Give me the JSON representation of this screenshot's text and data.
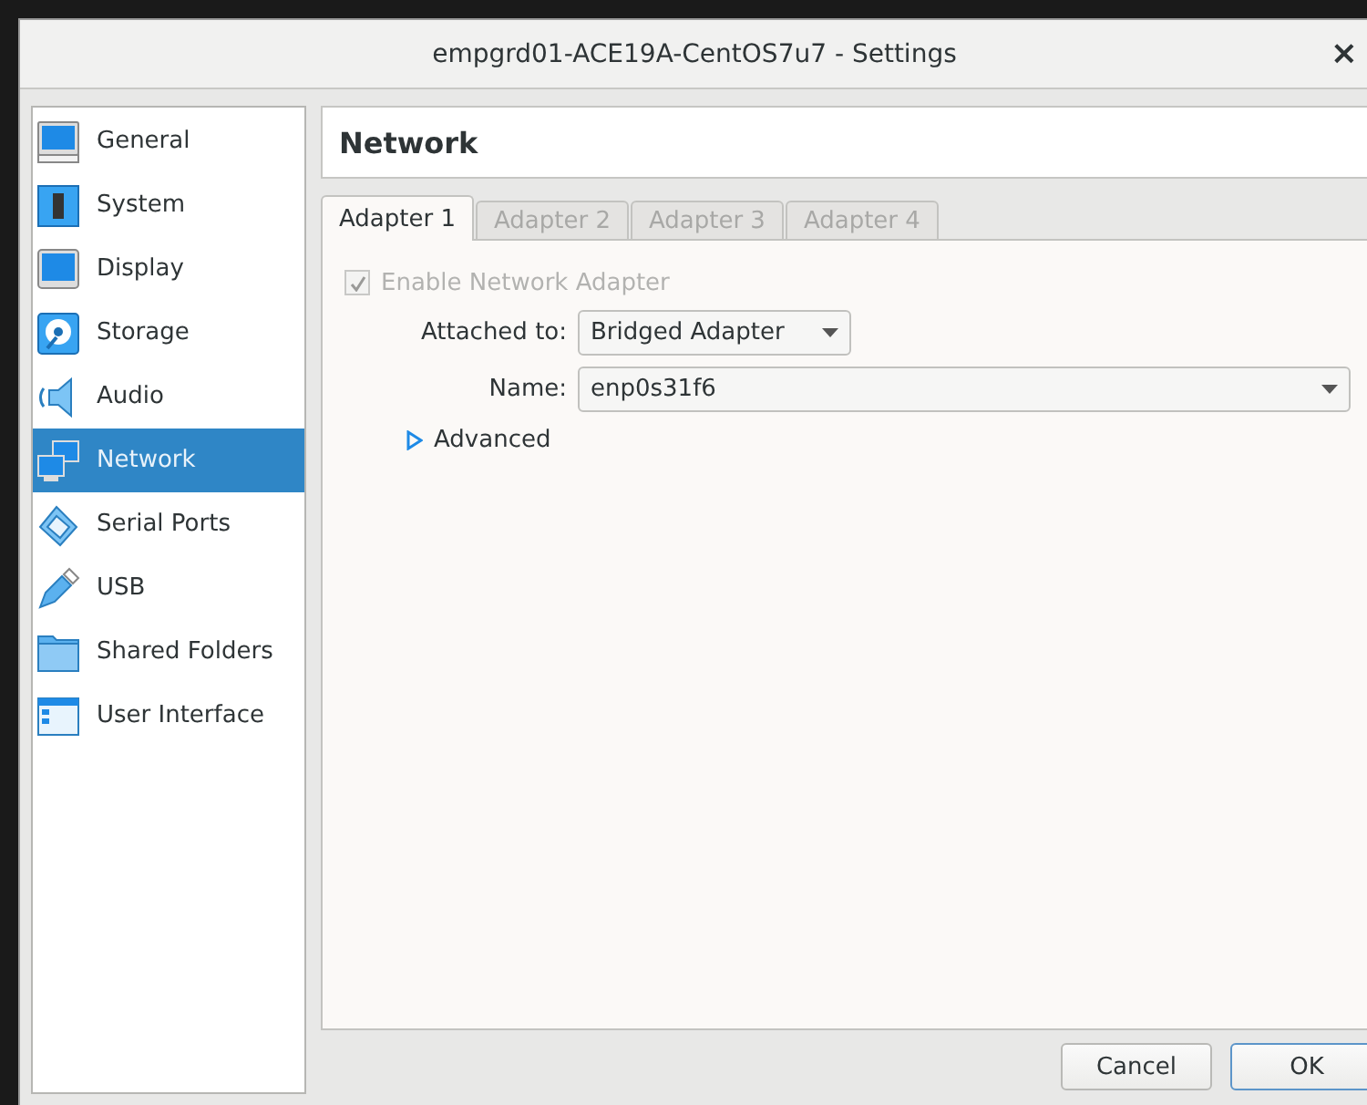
{
  "window": {
    "title": "empgrd01-ACE19A-CentOS7u7 - Settings",
    "close": "×"
  },
  "sidebar": {
    "items": [
      {
        "label": "General",
        "selected": false
      },
      {
        "label": "System",
        "selected": false
      },
      {
        "label": "Display",
        "selected": false
      },
      {
        "label": "Storage",
        "selected": false
      },
      {
        "label": "Audio",
        "selected": false
      },
      {
        "label": "Network",
        "selected": true
      },
      {
        "label": "Serial Ports",
        "selected": false
      },
      {
        "label": "USB",
        "selected": false
      },
      {
        "label": "Shared Folders",
        "selected": false
      },
      {
        "label": "User Interface",
        "selected": false
      }
    ]
  },
  "page": {
    "title": "Network"
  },
  "tabs": [
    {
      "label": "Adapter 1",
      "selected": true
    },
    {
      "label": "Adapter 2",
      "selected": false
    },
    {
      "label": "Adapter 3",
      "selected": false
    },
    {
      "label": "Adapter 4",
      "selected": false
    }
  ],
  "enable": {
    "label": "Enable Network Adapter",
    "checked": true,
    "disabled": true
  },
  "attached_to": {
    "label": "Attached to:",
    "value": "Bridged Adapter"
  },
  "name": {
    "label": "Name:",
    "value": "enp0s31f6"
  },
  "advanced": {
    "label": "Advanced",
    "expanded": false
  },
  "buttons": [
    {
      "label": "Cancel",
      "default": false
    },
    {
      "label": "OK",
      "default": true
    }
  ]
}
